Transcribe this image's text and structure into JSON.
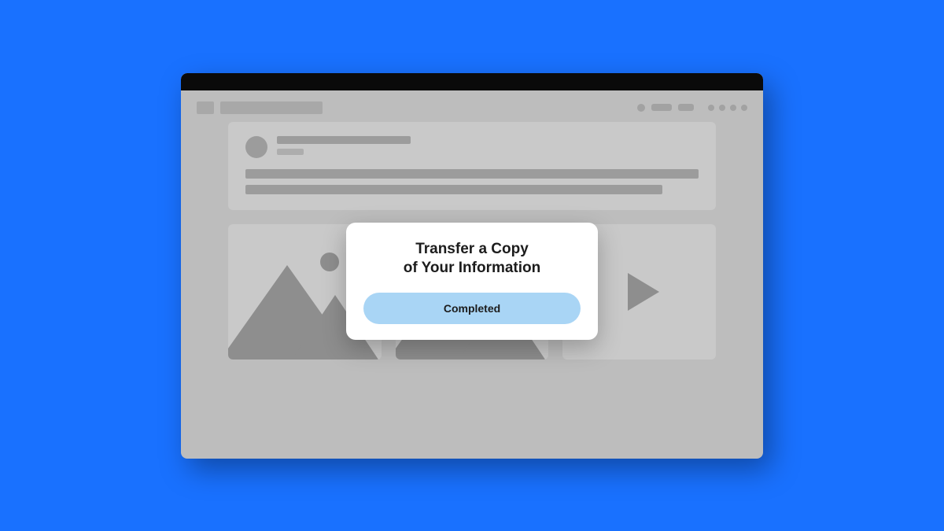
{
  "modal": {
    "title_line1": "Transfer a Copy",
    "title_line2": "of Your Information",
    "status_label": "Completed"
  },
  "colors": {
    "background": "#1971ff",
    "window_bg": "#bdbdbd",
    "placeholder": "#9c9c9c",
    "card_bg": "#c9c9c9",
    "button_bg": "#a9d5f5"
  },
  "icons": {
    "photo1": "image-icon",
    "photo2": "image-icon",
    "video": "play-icon"
  }
}
